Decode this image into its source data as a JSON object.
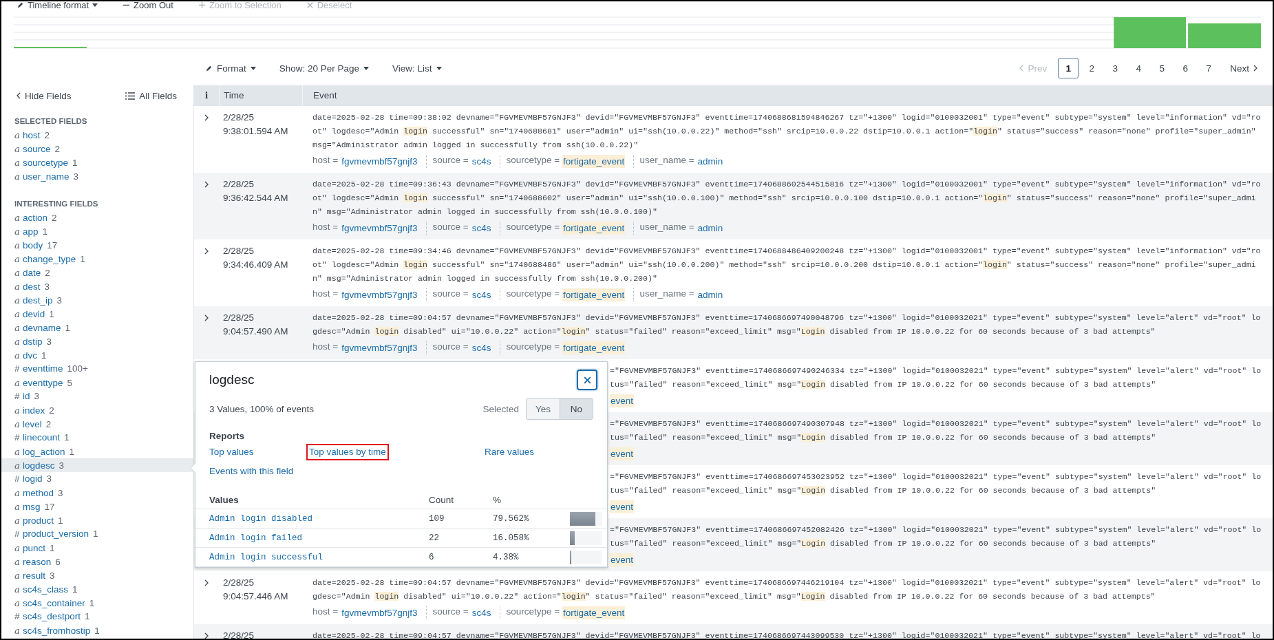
{
  "timeline_toolbar": [
    {
      "label": "Timeline format",
      "kind": "pencil",
      "has_caret": true,
      "disabled": false
    },
    {
      "label": "Zoom Out",
      "kind": "minus",
      "has_caret": false,
      "disabled": false
    },
    {
      "label": "Zoom to Selection",
      "kind": "plus",
      "has_caret": false,
      "disabled": true
    },
    {
      "label": "Deselect",
      "kind": "cross",
      "has_caret": false,
      "disabled": true
    }
  ],
  "view_controls": [
    {
      "label": "Format",
      "kind": "pencil"
    },
    {
      "label": "Show: 20 Per Page",
      "kind": "plain"
    },
    {
      "label": "View: List",
      "kind": "plain"
    }
  ],
  "pagination": {
    "prev": {
      "label": "Prev",
      "disabled": true
    },
    "pages": [
      {
        "label": "1",
        "selected": true
      },
      {
        "label": "2",
        "selected": false
      },
      {
        "label": "3",
        "selected": false
      },
      {
        "label": "4",
        "selected": false
      },
      {
        "label": "5",
        "selected": false
      },
      {
        "label": "6",
        "selected": false
      },
      {
        "label": "7",
        "selected": false
      }
    ],
    "next": {
      "label": "Next",
      "disabled": false
    }
  },
  "sidebar": {
    "hide_label": "Hide Fields",
    "all_label": "All Fields",
    "sections": [
      {
        "title": "SELECTED FIELDS",
        "fields": [
          {
            "type_mark": "a",
            "kind": "string",
            "name": "host",
            "count": "2",
            "selected": false
          },
          {
            "type_mark": "a",
            "kind": "string",
            "name": "source",
            "count": "2",
            "selected": false
          },
          {
            "type_mark": "a",
            "kind": "string",
            "name": "sourcetype",
            "count": "1",
            "selected": false
          },
          {
            "type_mark": "a",
            "kind": "string",
            "name": "user_name",
            "count": "3",
            "selected": false
          }
        ]
      },
      {
        "title": "INTERESTING FIELDS",
        "fields": [
          {
            "type_mark": "a",
            "kind": "string",
            "name": "action",
            "count": "2",
            "selected": false
          },
          {
            "type_mark": "a",
            "kind": "string",
            "name": "app",
            "count": "1",
            "selected": false
          },
          {
            "type_mark": "a",
            "kind": "string",
            "name": "body",
            "count": "17",
            "selected": false
          },
          {
            "type_mark": "a",
            "kind": "string",
            "name": "change_type",
            "count": "1",
            "selected": false
          },
          {
            "type_mark": "a",
            "kind": "string",
            "name": "date",
            "count": "2",
            "selected": false
          },
          {
            "type_mark": "a",
            "kind": "string",
            "name": "dest",
            "count": "3",
            "selected": false
          },
          {
            "type_mark": "a",
            "kind": "string",
            "name": "dest_ip",
            "count": "3",
            "selected": false
          },
          {
            "type_mark": "a",
            "kind": "string",
            "name": "devid",
            "count": "1",
            "selected": false
          },
          {
            "type_mark": "a",
            "kind": "string",
            "name": "devname",
            "count": "1",
            "selected": false
          },
          {
            "type_mark": "a",
            "kind": "string",
            "name": "dstip",
            "count": "3",
            "selected": false
          },
          {
            "type_mark": "a",
            "kind": "string",
            "name": "dvc",
            "count": "1",
            "selected": false
          },
          {
            "type_mark": "#",
            "kind": "number",
            "name": "eventtime",
            "count": "100+",
            "selected": false
          },
          {
            "type_mark": "a",
            "kind": "string",
            "name": "eventtype",
            "count": "5",
            "selected": false
          },
          {
            "type_mark": "#",
            "kind": "number",
            "name": "id",
            "count": "3",
            "selected": false
          },
          {
            "type_mark": "a",
            "kind": "string",
            "name": "index",
            "count": "2",
            "selected": false
          },
          {
            "type_mark": "a",
            "kind": "string",
            "name": "level",
            "count": "2",
            "selected": false
          },
          {
            "type_mark": "#",
            "kind": "number",
            "name": "linecount",
            "count": "1",
            "selected": false
          },
          {
            "type_mark": "a",
            "kind": "string",
            "name": "log_action",
            "count": "1",
            "selected": false
          },
          {
            "type_mark": "a",
            "kind": "string",
            "name": "logdesc",
            "count": "3",
            "selected": true
          },
          {
            "type_mark": "#",
            "kind": "number",
            "name": "logid",
            "count": "3",
            "selected": false
          },
          {
            "type_mark": "a",
            "kind": "string",
            "name": "method",
            "count": "3",
            "selected": false
          },
          {
            "type_mark": "a",
            "kind": "string",
            "name": "msg",
            "count": "17",
            "selected": false
          },
          {
            "type_mark": "a",
            "kind": "string",
            "name": "product",
            "count": "1",
            "selected": false
          },
          {
            "type_mark": "#",
            "kind": "number",
            "name": "product_version",
            "count": "1",
            "selected": false
          },
          {
            "type_mark": "a",
            "kind": "string",
            "name": "punct",
            "count": "1",
            "selected": false
          },
          {
            "type_mark": "a",
            "kind": "string",
            "name": "reason",
            "count": "6",
            "selected": false
          },
          {
            "type_mark": "a",
            "kind": "string",
            "name": "result",
            "count": "3",
            "selected": false
          },
          {
            "type_mark": "a",
            "kind": "string",
            "name": "sc4s_class",
            "count": "1",
            "selected": false
          },
          {
            "type_mark": "a",
            "kind": "string",
            "name": "sc4s_container",
            "count": "1",
            "selected": false
          },
          {
            "type_mark": "#",
            "kind": "number",
            "name": "sc4s_destport",
            "count": "1",
            "selected": false
          },
          {
            "type_mark": "a",
            "kind": "string",
            "name": "sc4s_fromhostip",
            "count": "1",
            "selected": false
          }
        ]
      }
    ]
  },
  "table": {
    "columns": [
      "i",
      "Time",
      "Event"
    ],
    "events": [
      {
        "kind": "full",
        "date": "2/28/25",
        "time": "9:38:01.594 AM",
        "lines": [
          [
            {
              "text": "date=2025-02-28 time=09:38:02 devname=\"FGVMEVMBF57GNJF3\" devid=\"FGVMEVMBF57GNJF3\" eventtime=1740688681594846267 tz=\"+1300\" logid=\"0100032001\" type=\"event\" subtype=\"system\" level=\"information\" vd=\"ro",
              "highlighted": false
            }
          ],
          [
            {
              "text": "ot\" logdesc=\"Admin ",
              "highlighted": false
            },
            {
              "text": "login",
              "highlighted": true
            },
            {
              "text": " successful\" sn=\"1740688681\" user=\"admin\" ui=\"ssh(10.0.0.22)\" method=\"ssh\" srcip=10.0.0.22 dstip=10.0.0.1 action=\"",
              "highlighted": false
            },
            {
              "text": "login",
              "highlighted": true
            },
            {
              "text": "\" status=\"success\" reason=\"none\" profile=\"super_admin\"",
              "highlighted": false
            }
          ],
          [
            {
              "text": "msg=\"Administrator admin logged in successfully from ssh(10.0.0.22)\"",
              "highlighted": false
            }
          ]
        ],
        "tags": [
          {
            "key": "host =",
            "value": "fgvmevmbf57gnjf3",
            "highlighted": false
          },
          {
            "key": "source =",
            "value": "sc4s",
            "highlighted": false
          },
          {
            "key": "sourcetype =",
            "value": "fortigate_event",
            "highlighted": true
          },
          {
            "key": "user_name =",
            "value": "admin",
            "highlighted": false
          }
        ]
      },
      {
        "kind": "full",
        "date": "2/28/25",
        "time": "9:36:42.544 AM",
        "lines": [
          [
            {
              "text": "date=2025-02-28 time=09:36:43 devname=\"FGVMEVMBF57GNJF3\" devid=\"FGVMEVMBF57GNJF3\" eventtime=1740688602544515816 tz=\"+1300\" logid=\"0100032001\" type=\"event\" subtype=\"system\" level=\"information\" vd=\"ro",
              "highlighted": false
            }
          ],
          [
            {
              "text": "ot\" logdesc=\"Admin ",
              "highlighted": false
            },
            {
              "text": "login",
              "highlighted": true
            },
            {
              "text": " successful\" sn=\"1740688602\" user=\"admin\" ui=\"ssh(10.0.0.100)\" method=\"ssh\" srcip=10.0.0.100 dstip=10.0.0.1 action=\"",
              "highlighted": false
            },
            {
              "text": "login",
              "highlighted": true
            },
            {
              "text": "\" status=\"success\" reason=\"none\" profile=\"super_admi",
              "highlighted": false
            }
          ],
          [
            {
              "text": "n\" msg=\"Administrator admin logged in successfully from ssh(10.0.0.100)\"",
              "highlighted": false
            }
          ]
        ],
        "tags": [
          {
            "key": "host =",
            "value": "fgvmevmbf57gnjf3",
            "highlighted": false
          },
          {
            "key": "source =",
            "value": "sc4s",
            "highlighted": false
          },
          {
            "key": "sourcetype =",
            "value": "fortigate_event",
            "highlighted": true
          },
          {
            "key": "user_name =",
            "value": "admin",
            "highlighted": false
          }
        ]
      },
      {
        "kind": "full",
        "date": "2/28/25",
        "time": "9:34:46.409 AM",
        "lines": [
          [
            {
              "text": "date=2025-02-28 time=09:34:46 devname=\"FGVMEVMBF57GNJF3\" devid=\"FGVMEVMBF57GNJF3\" eventtime=1740688486409200248 tz=\"+1300\" logid=\"0100032001\" type=\"event\" subtype=\"system\" level=\"information\" vd=\"ro",
              "highlighted": false
            }
          ],
          [
            {
              "text": "ot\" logdesc=\"Admin ",
              "highlighted": false
            },
            {
              "text": "login",
              "highlighted": true
            },
            {
              "text": " successful\" sn=\"1740688486\" user=\"admin\" ui=\"ssh(10.0.0.200)\" method=\"ssh\" srcip=10.0.0.200 dstip=10.0.0.1 action=\"",
              "highlighted": false
            },
            {
              "text": "login",
              "highlighted": true
            },
            {
              "text": "\" status=\"success\" reason=\"none\" profile=\"super_admi",
              "highlighted": false
            }
          ],
          [
            {
              "text": "n\" msg=\"Administrator admin logged in successfully from ssh(10.0.0.200)\"",
              "highlighted": false
            }
          ]
        ],
        "tags": [
          {
            "key": "host =",
            "value": "fgvmevmbf57gnjf3",
            "highlighted": false
          },
          {
            "key": "source =",
            "value": "sc4s",
            "highlighted": false
          },
          {
            "key": "sourcetype =",
            "value": "fortigate_event",
            "highlighted": true
          },
          {
            "key": "user_name =",
            "value": "admin",
            "highlighted": false
          }
        ]
      },
      {
        "kind": "full",
        "date": "2/28/25",
        "time": "9:04:57.490 AM",
        "lines": [
          [
            {
              "text": "date=2025-02-28 time=09:04:57 devname=\"FGVMEVMBF57GNJF3\" devid=\"FGVMEVMBF57GNJF3\" eventtime=1740686697490048796 tz=\"+1300\" logid=\"0100032021\" type=\"event\" subtype=\"system\" level=\"alert\" vd=\"root\" lo",
              "highlighted": false
            }
          ],
          [
            {
              "text": "gdesc=\"Admin ",
              "highlighted": false
            },
            {
              "text": "login",
              "highlighted": true
            },
            {
              "text": " disabled\" ui=\"10.0.0.22\" action=\"",
              "highlighted": false
            },
            {
              "text": "login",
              "highlighted": true
            },
            {
              "text": "\" status=\"failed\" reason=\"exceed_limit\" msg=\"",
              "highlighted": false
            },
            {
              "text": "Login",
              "highlighted": true
            },
            {
              "text": " disabled from IP 10.0.0.22 for 60 seconds because of 3 bad attempts\"",
              "highlighted": false
            }
          ]
        ],
        "tags": [
          {
            "key": "host =",
            "value": "fgvmevmbf57gnjf3",
            "highlighted": false
          },
          {
            "key": "source =",
            "value": "sc4s",
            "highlighted": false
          },
          {
            "key": "sourcetype =",
            "value": "fortigate_event",
            "highlighted": true
          }
        ]
      },
      {
        "kind": "covered",
        "lines": [
          [
            {
              "text": "=\"FGVMEVMBF57GNJF3\" eventtime=1740686697490246334 tz=\"+1300\" logid=\"0100032021\" type=\"event\" subtype=\"system\" level=\"alert\" vd=\"root\" lo",
              "highlighted": false
            }
          ],
          [
            {
              "text": "tus=\"failed\" reason=\"exceed_limit\" msg=\"",
              "highlighted": false
            },
            {
              "text": "Login",
              "highlighted": true
            },
            {
              "text": " disabled from IP 10.0.0.22 for 60 seconds because of 3 bad attempts\"",
              "highlighted": false
            }
          ]
        ],
        "tags": [
          {
            "value": "event",
            "highlighted": true
          }
        ]
      },
      {
        "kind": "covered",
        "lines": [
          [
            {
              "text": "=\"FGVMEVMBF57GNJF3\" eventtime=1740686697490307948 tz=\"+1300\" logid=\"0100032021\" type=\"event\" subtype=\"system\" level=\"alert\" vd=\"root\" lo",
              "highlighted": false
            }
          ],
          [
            {
              "text": "tus=\"failed\" reason=\"exceed_limit\" msg=\"",
              "highlighted": false
            },
            {
              "text": "Login",
              "highlighted": true
            },
            {
              "text": " disabled from IP 10.0.0.22 for 60 seconds because of 3 bad attempts\"",
              "highlighted": false
            }
          ]
        ],
        "tags": [
          {
            "value": "event",
            "highlighted": true
          }
        ]
      },
      {
        "kind": "covered",
        "lines": [
          [
            {
              "text": "=\"FGVMEVMBF57GNJF3\" eventtime=1740686697453023952 tz=\"+1300\" logid=\"0100032021\" type=\"event\" subtype=\"system\" level=\"alert\" vd=\"root\" lo",
              "highlighted": false
            }
          ],
          [
            {
              "text": "tus=\"failed\" reason=\"exceed_limit\" msg=\"",
              "highlighted": false
            },
            {
              "text": "Login",
              "highlighted": true
            },
            {
              "text": " disabled from IP 10.0.0.22 for 60 seconds because of 3 bad attempts\"",
              "highlighted": false
            }
          ]
        ],
        "tags": [
          {
            "value": "event",
            "highlighted": true
          }
        ]
      },
      {
        "kind": "covered",
        "lines": [
          [
            {
              "text": "=\"FGVMEVMBF57GNJF3\" eventtime=1740686697452082426 tz=\"+1300\" logid=\"0100032021\" type=\"event\" subtype=\"system\" level=\"alert\" vd=\"root\" lo",
              "highlighted": false
            }
          ],
          [
            {
              "text": "tus=\"failed\" reason=\"exceed_limit\" msg=\"",
              "highlighted": false
            },
            {
              "text": "Login",
              "highlighted": true
            },
            {
              "text": " disabled from IP 10.0.0.22 for 60 seconds because of 3 bad attempts\"",
              "highlighted": false
            }
          ]
        ],
        "tags": [
          {
            "value": "event",
            "highlighted": true
          }
        ]
      },
      {
        "kind": "full",
        "date": "2/28/25",
        "time": "9:04:57.446 AM",
        "lines": [
          [
            {
              "text": "date=2025-02-28 time=09:04:57 devname=\"FGVMEVMBF57GNJF3\" devid=\"FGVMEVMBF57GNJF3\" eventtime=1740686697446219104 tz=\"+1300\" logid=\"0100032021\" type=\"event\" subtype=\"system\" level=\"alert\" vd=\"root\" lo",
              "highlighted": false
            }
          ],
          [
            {
              "text": "gdesc=\"Admin ",
              "highlighted": false
            },
            {
              "text": "login",
              "highlighted": true
            },
            {
              "text": " disabled\" ui=\"10.0.0.22\" action=\"",
              "highlighted": false
            },
            {
              "text": "login",
              "highlighted": true
            },
            {
              "text": "\" status=\"failed\" reason=\"exceed_limit\" msg=\"",
              "highlighted": false
            },
            {
              "text": "Login",
              "highlighted": true
            },
            {
              "text": " disabled from IP 10.0.0.22 for 60 seconds because of 3 bad attempts\"",
              "highlighted": false
            }
          ]
        ],
        "tags": [
          {
            "key": "host =",
            "value": "fgvmevmbf57gnjf3",
            "highlighted": false
          },
          {
            "key": "source =",
            "value": "sc4s",
            "highlighted": false
          },
          {
            "key": "sourcetype =",
            "value": "fortigate_event",
            "highlighted": true
          }
        ]
      },
      {
        "kind": "full",
        "date": "2/28/25",
        "lines": [
          [
            {
              "text": "date=2025-02-28 time=09:04:57 devname=\"FGVMEVMBF57GNJF3\" devid=\"FGVMEVMBF57GNJF3\" eventtime=1740686697443099530 tz=\"+1300\" logid=\"0100032021\" type=\"event\" subtype=\"system\" level=\"alert\" vd=\"root\" lo",
              "highlighted": false
            }
          ]
        ]
      }
    ]
  },
  "field_popup": {
    "title": "logdesc",
    "summary": "3 Values, 100% of events",
    "selected_label": "Selected",
    "toggle": [
      {
        "label": "Yes",
        "selected": false
      },
      {
        "label": "No",
        "selected": true
      }
    ],
    "reports_title": "Reports",
    "reports": [
      {
        "label": "Top values",
        "outlined": false
      },
      {
        "label": "Top values by time",
        "outlined": true
      },
      {
        "label": "Rare values",
        "outlined": false
      },
      {
        "label": "Events with this field",
        "outlined": false
      }
    ],
    "columns": [
      "Values",
      "Count",
      "%"
    ],
    "values": [
      {
        "value": "Admin login disabled",
        "count": "109",
        "percent": "79.562%",
        "level": 0.7956
      },
      {
        "value": "Admin login failed",
        "count": "22",
        "percent": "16.058%",
        "level": 0.1606
      },
      {
        "value": "Admin login successful",
        "count": "6",
        "percent": "4.38%",
        "level": 0.0438
      }
    ]
  }
}
